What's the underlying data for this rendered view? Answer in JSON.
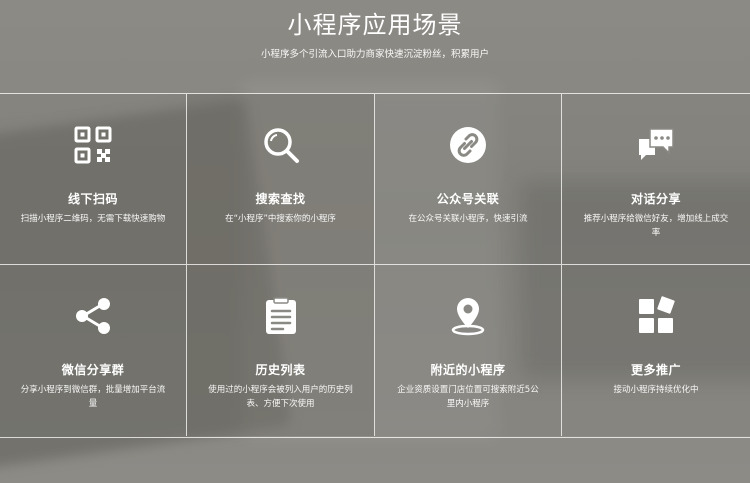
{
  "header": {
    "title": "小程序应用场景",
    "subtitle": "小程序多个引流入口助力商家快速沉淀粉丝，积累用户"
  },
  "cards": [
    {
      "title": "线下扫码",
      "desc": "扫描小程序二维码，无需下载快速购物",
      "icon": "qr-code-icon"
    },
    {
      "title": "搜索查找",
      "desc": "在“小程序”中搜索你的小程序",
      "icon": "search-icon"
    },
    {
      "title": "公众号关联",
      "desc": "在公众号关联小程序，快速引流",
      "icon": "link-icon"
    },
    {
      "title": "对话分享",
      "desc": "推荐小程序给微信好友，增加线上成交率",
      "icon": "chat-icon"
    },
    {
      "title": "微信分享群",
      "desc": "分享小程序到微信群，批量增加平台流量",
      "icon": "share-icon"
    },
    {
      "title": "历史列表",
      "desc": "使用过的小程序会被列入用户的历史列表、方便下次使用",
      "icon": "clipboard-list-icon"
    },
    {
      "title": "附近的小程序",
      "desc": "企业资质设置门店位置可搜索附近5公里内小程序",
      "icon": "location-pin-icon"
    },
    {
      "title": "更多推广",
      "desc": "接动小程序持续优化中",
      "icon": "blocks-icon"
    }
  ]
}
